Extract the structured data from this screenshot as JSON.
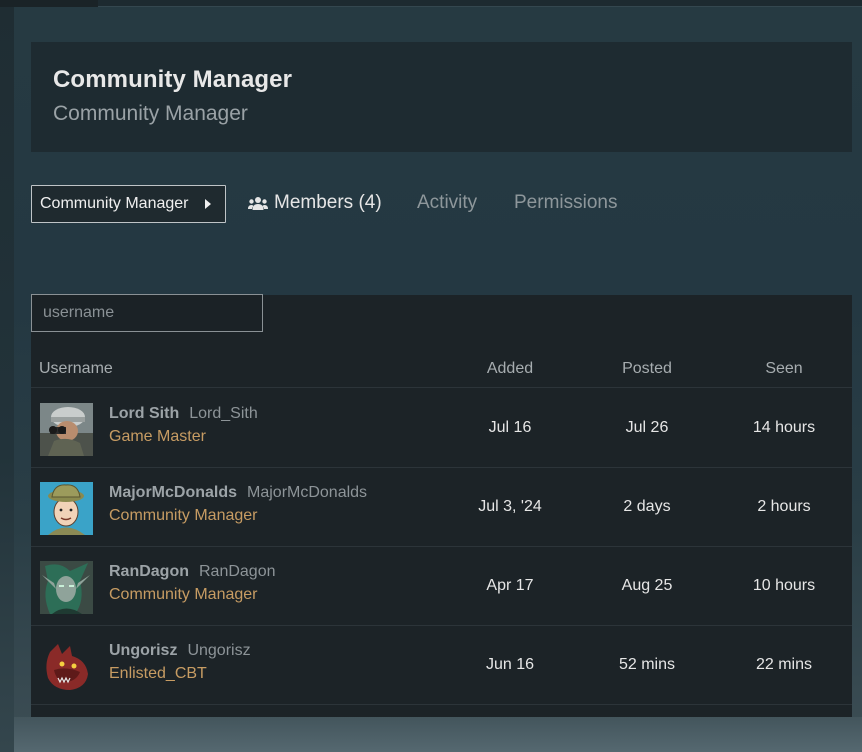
{
  "header": {
    "title": "Community Manager",
    "subtitle": "Community Manager"
  },
  "group_button": {
    "label": "Community Manager"
  },
  "tabs": [
    {
      "label": "Members (4)",
      "icon": "users-icon",
      "active": true
    },
    {
      "label": "Activity",
      "active": false
    },
    {
      "label": "Permissions",
      "active": false
    }
  ],
  "search": {
    "placeholder": "username",
    "value": ""
  },
  "table": {
    "columns": [
      "Username",
      "Added",
      "Posted",
      "Seen"
    ],
    "rows": [
      {
        "display_name": "Lord Sith",
        "login": "Lord_Sith",
        "role": "Game Master",
        "added": "Jul 16",
        "posted": "Jul 26",
        "seen": "14 hours",
        "avatar": "soldier-avatar"
      },
      {
        "display_name": "MajorMcDonalds",
        "login": "MajorMcDonalds",
        "role": "Community Manager",
        "added": "Jul 3, '24",
        "posted": "2 days",
        "seen": "2 hours",
        "avatar": "cartoon-soldier-avatar"
      },
      {
        "display_name": "RanDagon",
        "login": "RanDagon",
        "role": "Community Manager",
        "added": "Apr 17",
        "posted": "Aug 25",
        "seen": "10 hours",
        "avatar": "elf-avatar"
      },
      {
        "display_name": "Ungorisz",
        "login": "Ungorisz",
        "role": "Enlisted_CBT",
        "added": "Jun 16",
        "posted": "52 mins",
        "seen": "22 mins",
        "avatar": "dragon-avatar"
      }
    ]
  },
  "colors": {
    "role": "#c79c63",
    "panel": "#1c2327",
    "header": "#1e2b31"
  }
}
